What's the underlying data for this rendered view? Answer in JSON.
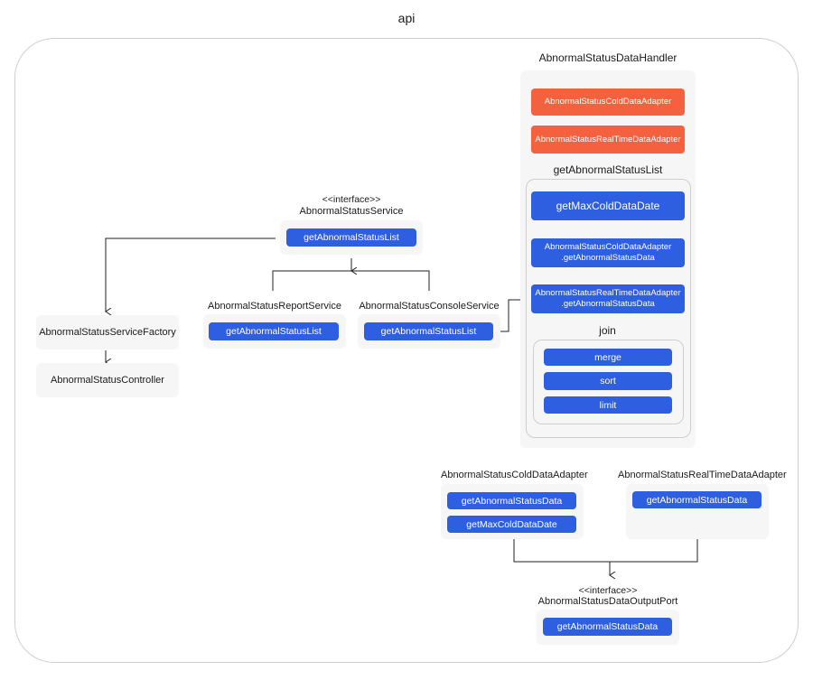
{
  "title": "api",
  "handler": {
    "title": "AbnormalStatusDataHandler",
    "cold_adapter": "AbnormalStatusColdDataAdapter",
    "realtime_adapter": "AbnormalStatusRealTimeDataAdapter",
    "list_title": "getAbnormalStatusList",
    "max_cold": "getMaxColdDataDate",
    "cold_call_1": "AbnormalStatusColdDataAdapter",
    "cold_call_2": ".getAbnormalStatusData",
    "rt_call_1": "AbnormalStatusRealTimeDataAdapter",
    "rt_call_2": ".getAbnormalStatusData",
    "join_title": "join",
    "merge": "merge",
    "sort": "sort",
    "limit": "limit"
  },
  "service": {
    "stereotype": "<<interface>>",
    "title": "AbnormalStatusService",
    "method": "getAbnormalStatusList"
  },
  "report": {
    "title": "AbnormalStatusReportService",
    "method": "getAbnormalStatusList"
  },
  "console": {
    "title": "AbnormalStatusConsoleService",
    "method": "getAbnormalStatusList"
  },
  "factory": {
    "title": "AbnormalStatusServiceFactory"
  },
  "controller": {
    "title": "AbnormalStatusController"
  },
  "cold_adapter": {
    "title": "AbnormalStatusColdDataAdapter",
    "method1": "getAbnormalStatusData",
    "method2": "getMaxColdDataDate"
  },
  "rt_adapter": {
    "title": "AbnormalStatusRealTimeDataAdapter",
    "method1": "getAbnormalStatusData"
  },
  "output_port": {
    "stereotype": "<<interface>>",
    "title": "AbnormalStatusDataOutputPort",
    "method": "getAbnormalStatusData"
  },
  "colors": {
    "blue": "#2f5fe1",
    "orange": "#f4613f",
    "panel": "#f6f6f6"
  }
}
